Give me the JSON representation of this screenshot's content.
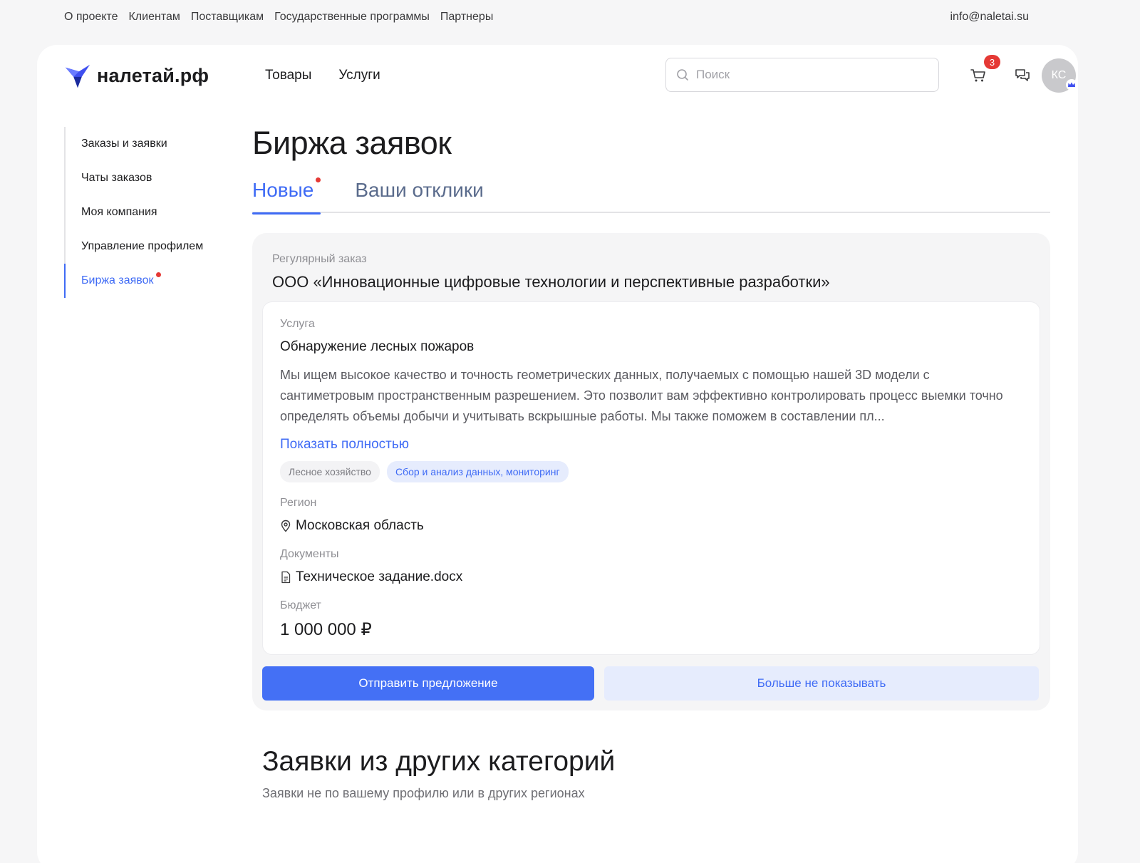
{
  "topbar": {
    "links": [
      "О проекте",
      "Клиентам",
      "Поставщикам",
      "Государственные программы",
      "Партнеры"
    ],
    "email": "info@naletai.su"
  },
  "header": {
    "logo_text": "налетай.рф",
    "nav": [
      "Товары",
      "Услуги"
    ],
    "search_placeholder": "Поиск",
    "cart_count": "3",
    "avatar_initials": "КС"
  },
  "sidebar": {
    "items": [
      {
        "label": "Заказы и заявки"
      },
      {
        "label": "Чаты заказов"
      },
      {
        "label": "Моя компания"
      },
      {
        "label": "Управление профилем"
      },
      {
        "label": "Биржа заявок"
      }
    ]
  },
  "main": {
    "title": "Биржа заявок",
    "tabs": [
      {
        "label": "Новые"
      },
      {
        "label": "Ваши отклики"
      }
    ]
  },
  "order": {
    "kind": "Регулярный заказ",
    "company": "ООО «Инновационные цифровые технологии и перспективные разработки»",
    "service_label": "Услуга",
    "service_name": "Обнаружение лесных пожаров",
    "description": "Мы ищем высокое качество и точность геометрических данных, получаемых с помощью нашей 3D модели с сантиметровым пространственным разрешением. Это позволит вам эффективно контролировать процесс выемки точно определять объемы добычи и учитывать вскрышные работы. Мы также поможем в составлении пл...",
    "show_more": "Показать полностью",
    "tags": [
      "Лесное хозяйство",
      "Сбор и анализ данных, мониторинг"
    ],
    "region_label": "Регион",
    "region": "Московская область",
    "documents_label": "Документы",
    "document": "Техническое задание.docx",
    "budget_label": "Бюджет",
    "budget": "1 000 000 ₽",
    "send_button": "Отправить предложение",
    "hide_button": "Больше не показывать"
  },
  "other": {
    "title": "Заявки из других категорий",
    "subtitle": "Заявки не по вашему профилю или в других регионах"
  },
  "colors": {
    "accent": "#3f6bf5",
    "badge": "#e53935"
  }
}
